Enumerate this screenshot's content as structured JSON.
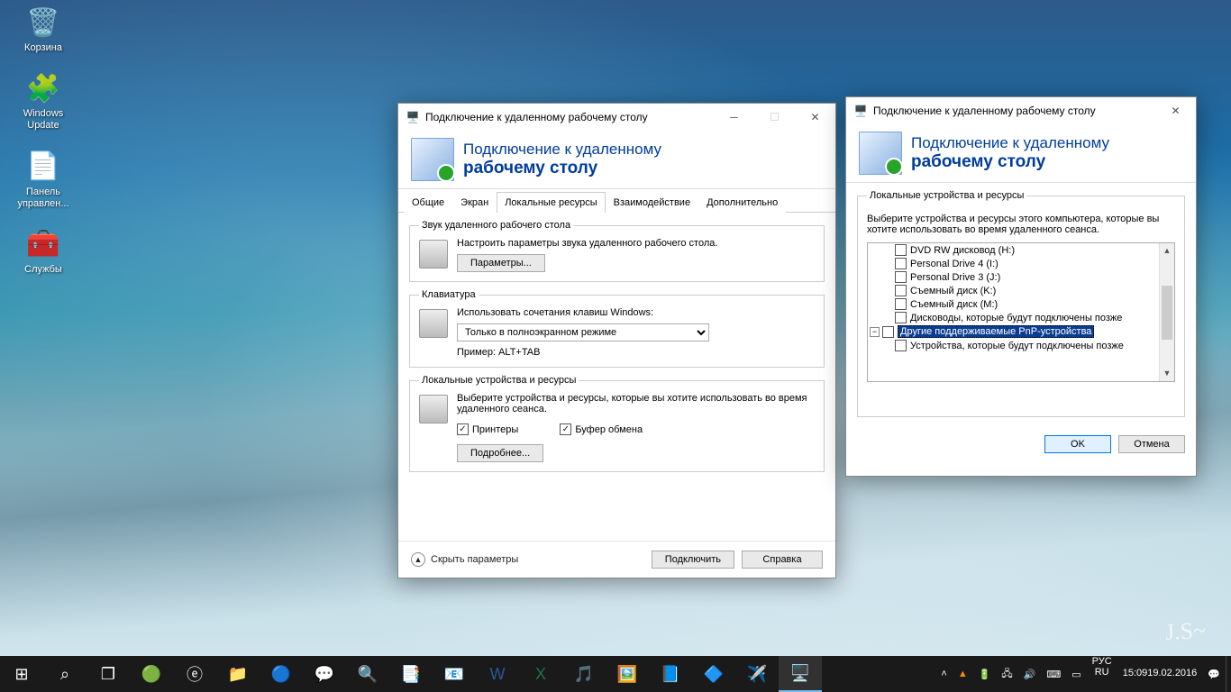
{
  "desktop": {
    "icons": [
      {
        "label": "Корзина",
        "glyph": "🗑️"
      },
      {
        "label": "Windows Update",
        "glyph": "🧩"
      },
      {
        "label": "Панель управлен...",
        "glyph": "📄"
      },
      {
        "label": "Службы",
        "glyph": "🧰"
      }
    ]
  },
  "main_window": {
    "title": "Подключение к удаленному рабочему столу",
    "banner_line1": "Подключение к удаленному",
    "banner_line2": "рабочему столу",
    "tabs": [
      "Общие",
      "Экран",
      "Локальные ресурсы",
      "Взаимодействие",
      "Дополнительно"
    ],
    "active_tab": 2,
    "group_audio": {
      "legend": "Звук удаленного рабочего стола",
      "desc": "Настроить параметры звука удаленного рабочего стола.",
      "button": "Параметры..."
    },
    "group_keyboard": {
      "legend": "Клавиатура",
      "desc": "Использовать сочетания клавиш Windows:",
      "selected": "Только в полноэкранном режиме",
      "example": "Пример: ALT+TAB"
    },
    "group_local": {
      "legend": "Локальные устройства и ресурсы",
      "desc": "Выберите устройства и ресурсы, которые вы хотите использовать во время удаленного сеанса.",
      "chk_printers": "Принтеры",
      "chk_clip": "Буфер обмена",
      "button": "Подробнее..."
    },
    "hide_options": "Скрыть параметры",
    "btn_connect": "Подключить",
    "btn_help": "Справка"
  },
  "devices_window": {
    "title": "Подключение к удаленному рабочему столу",
    "banner_line1": "Подключение к удаленному",
    "banner_line2": "рабочему столу",
    "group_legend": "Локальные устройства и ресурсы",
    "desc": "Выберите устройства и ресурсы этого компьютера, которые вы хотите использовать во время удаленного сеанса.",
    "items": [
      "DVD RW дисковод (H:)",
      "Personal Drive 4 (I:)",
      "Personal Drive 3 (J:)",
      "Съемный диск (K:)",
      "Съемный диск (M:)",
      "Дисководы, которые будут подключены позже"
    ],
    "pnp_group": "Другие поддерживаемые PnP-устройства",
    "pnp_child": "Устройства, которые будут подключены позже",
    "btn_ok": "OK",
    "btn_cancel": "Отмена"
  },
  "taskbar": {
    "lang": "РУС",
    "lang2": "RU",
    "time": "15:09",
    "date": "19.02.2016"
  }
}
